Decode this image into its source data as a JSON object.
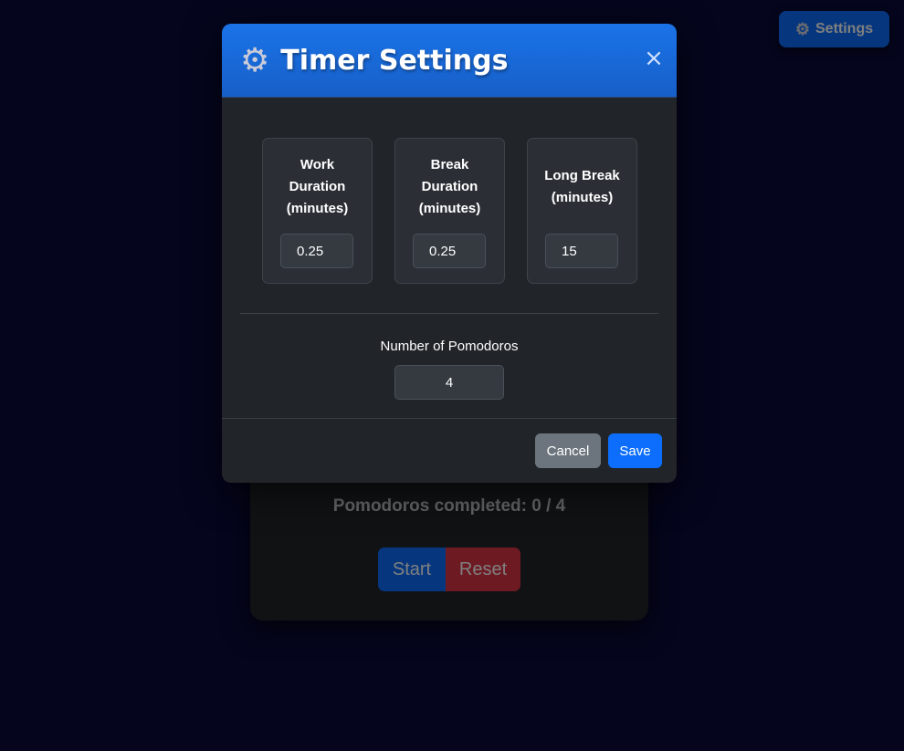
{
  "header_button": {
    "label": "Settings",
    "icon": "gear-icon"
  },
  "timer": {
    "pomodoros_completed_text": "Pomodoros completed: 0 / 4",
    "start_label": "Start",
    "reset_label": "Reset"
  },
  "modal": {
    "title": "Timer Settings",
    "title_icon": "gear-icon",
    "close_symbol": "×",
    "fields": [
      {
        "label_lines": [
          "Work",
          "Duration",
          "(minutes)"
        ],
        "value": "0.25"
      },
      {
        "label_lines": [
          "Break",
          "Duration",
          "(minutes)"
        ],
        "value": "0.25"
      },
      {
        "label_lines": [
          "Long Break",
          "(minutes)"
        ],
        "value": "15"
      }
    ],
    "pomodoros_label": "Number of Pomodoros",
    "pomodoros_value": "4",
    "cancel_label": "Cancel",
    "save_label": "Save"
  },
  "colors": {
    "background": "#0a0a3a",
    "primary": "#0d6efd",
    "danger": "#dc3545",
    "secondary": "#6c757d",
    "modal_body": "#212529"
  }
}
